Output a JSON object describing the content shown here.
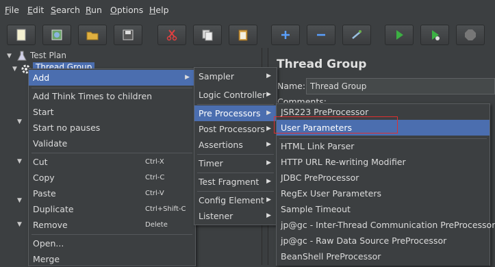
{
  "menubar": {
    "items": [
      {
        "label": "File",
        "mnemonic": "F",
        "rest": "ile"
      },
      {
        "label": "Edit",
        "mnemonic": "E",
        "rest": "dit"
      },
      {
        "label": "Search",
        "mnemonic": "S",
        "rest": "earch"
      },
      {
        "label": "Run",
        "mnemonic": "R",
        "rest": "un"
      },
      {
        "label": "Options",
        "mnemonic": "O",
        "rest": "ptions"
      },
      {
        "label": "Help",
        "mnemonic": "H",
        "rest": "elp"
      }
    ]
  },
  "toolbar": {
    "buttons": [
      "new-icon",
      "templates-icon",
      "open-icon",
      "save-icon",
      "cut-icon",
      "copy-icon",
      "paste-icon",
      "expand-icon",
      "collapse-icon",
      "toggle-icon",
      "start-icon",
      "start-no-pauses-icon",
      "stop-icon"
    ]
  },
  "tree": {
    "test_plan": "Test Plan",
    "thread_group": "Thread Group"
  },
  "right_panel": {
    "title": "Thread Group",
    "name_label": "Name:",
    "name_value": "Thread Group",
    "comments_label": "Comments:"
  },
  "context_menu": {
    "add": "Add",
    "add_think_times": "Add Think Times to children",
    "start": "Start",
    "start_no_pauses": "Start no pauses",
    "validate": "Validate",
    "cut": "Cut",
    "cut_shortcut": "Ctrl-X",
    "copy": "Copy",
    "copy_shortcut": "Ctrl-C",
    "paste": "Paste",
    "paste_shortcut": "Ctrl-V",
    "duplicate": "Duplicate",
    "duplicate_shortcut": "Ctrl+Shift-C",
    "remove": "Remove",
    "remove_shortcut": "Delete",
    "open": "Open...",
    "merge": "Merge"
  },
  "add_submenu": {
    "sampler": "Sampler",
    "logic_controller": "Logic Controller",
    "pre_processors": "Pre Processors",
    "post_processors": "Post Processors",
    "assertions": "Assertions",
    "timer": "Timer",
    "test_fragment": "Test Fragment",
    "config_element": "Config Element",
    "listener": "Listener"
  },
  "preprocessors_submenu": {
    "items": [
      "JSR223 PreProcessor",
      "User Parameters",
      "HTML Link Parser",
      "HTTP URL Re-writing Modifier",
      "JDBC PreProcessor",
      "RegEx User Parameters",
      "Sample Timeout",
      "jp@gc - Inter-Thread Communication PreProcessor",
      "jp@gc - Raw Data Source PreProcessor",
      "BeanShell PreProcessor"
    ],
    "selected": "User Parameters"
  },
  "colors": {
    "selection": "#4b6eaf",
    "highlight_box": "#e03030",
    "background": "#3c3f41"
  }
}
